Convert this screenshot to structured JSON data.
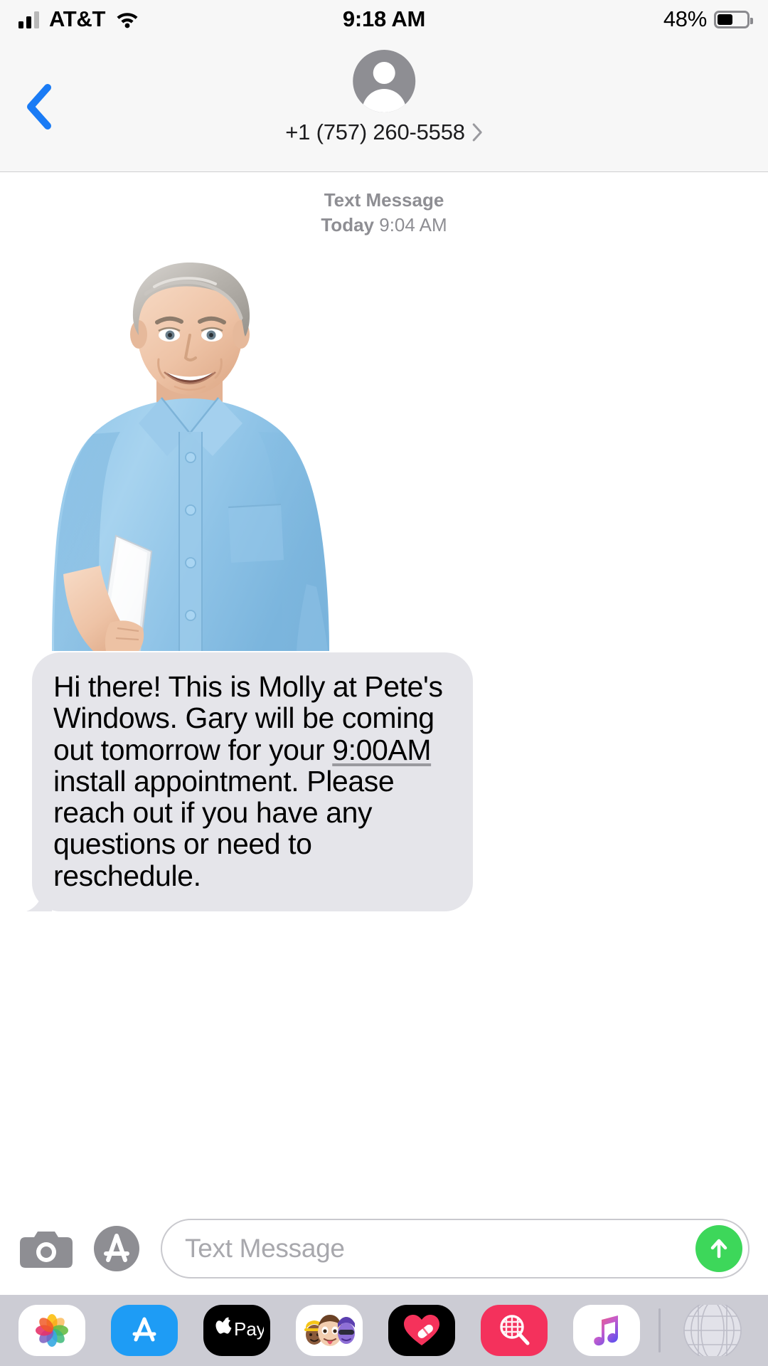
{
  "status_bar": {
    "carrier": "AT&T",
    "time": "9:18 AM",
    "battery_percent": "48%",
    "battery_level": 48,
    "signal_icon": "cellular-bars-icon",
    "wifi_icon": "wifi-icon",
    "battery_icon": "battery-icon"
  },
  "nav_header": {
    "back_icon": "chevron-left-icon",
    "avatar_icon": "person-placeholder-avatar",
    "contact_name": "+1 (757) 260-5558",
    "detail_chevron_icon": "chevron-right-icon"
  },
  "conversation": {
    "timestamp": {
      "kind": "Text Message",
      "day": "Today",
      "time": "9:04 AM"
    },
    "attachment": {
      "type": "image",
      "description": "Photo of a smiling middle-aged man with gray hair wearing a light blue dress shirt, holding a laptop under his arm, on a white background",
      "alt_name": "message-photo-attachment"
    },
    "message": {
      "sender": "incoming",
      "text_parts": [
        {
          "text": "Hi there! This is Molly at Pete's Windows. Gary will be coming out tomorrow for your ",
          "link": false
        },
        {
          "text": "9:00AM",
          "link": true
        },
        {
          "text": " install appointment. Please reach out if you have any questions or need to reschedule.",
          "link": false
        }
      ],
      "full_text": "Hi there! This is Molly at Pete's Windows. Gary will be coming out tomorrow for your 9:00AM install appointment. Please reach out if you have any questions or need to reschedule."
    }
  },
  "input_toolbar": {
    "camera_icon": "camera-icon",
    "apps_icon": "app-store-icon",
    "placeholder": "Text Message",
    "value": "",
    "send_icon": "send-arrow-up-icon"
  },
  "app_drawer": {
    "items": [
      {
        "name": "photos-app-icon",
        "label": "Photos"
      },
      {
        "name": "app-store-app-icon",
        "label": "App Store"
      },
      {
        "name": "apple-pay-app-icon",
        "label": "Apple Pay"
      },
      {
        "name": "memoji-app-icon",
        "label": "Memoji Stickers"
      },
      {
        "name": "digital-touch-app-icon",
        "label": "Digital Touch"
      },
      {
        "name": "images-search-app-icon",
        "label": "#images"
      },
      {
        "name": "apple-music-app-icon",
        "label": "Music"
      },
      {
        "name": "globe-app-icon",
        "label": "Globe"
      }
    ]
  },
  "colors": {
    "ios_blue": "#007AFF",
    "bubble_gray": "#E5E5EA",
    "send_green": "#3DD75A",
    "header_gray": "#F7F7F7",
    "drawer_gray": "#CCCCD4",
    "secondary_text": "#8E8E93"
  }
}
